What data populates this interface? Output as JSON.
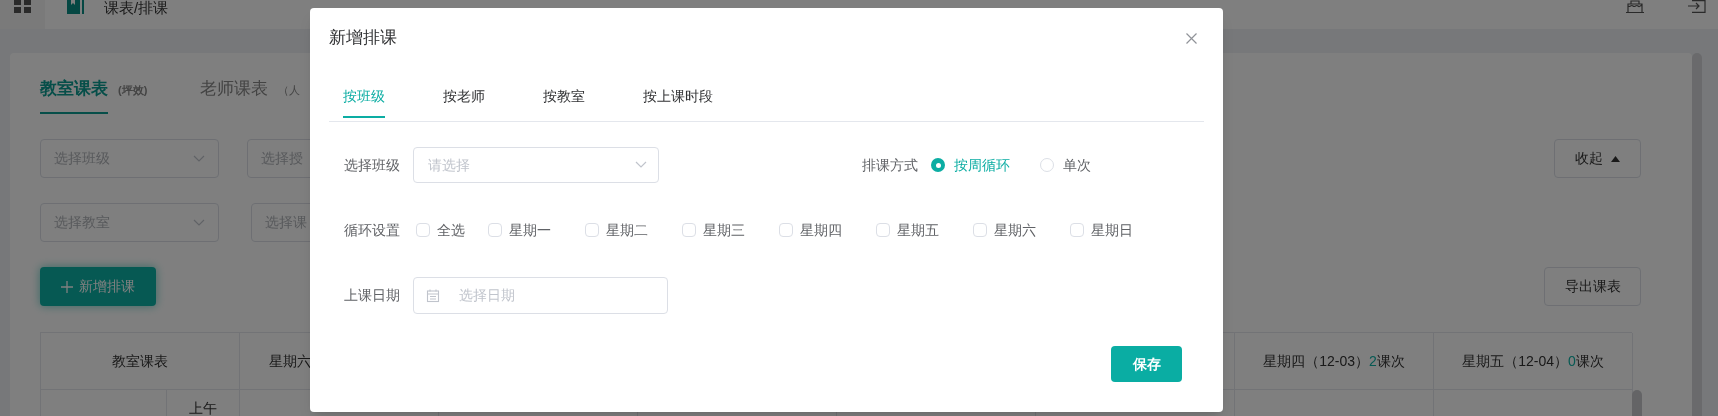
{
  "app_bar": {
    "breadcrumb": "课表/排课"
  },
  "page": {
    "tabs": [
      {
        "label": "教室课表",
        "note": "(坪效)",
        "selected": true
      },
      {
        "label": "老师课表",
        "note": "（人",
        "selected": false
      }
    ],
    "filters": [
      [
        {
          "placeholder": "选择班级"
        },
        {
          "placeholder": "选择授"
        }
      ],
      [
        {
          "placeholder": "选择教室"
        },
        {
          "placeholder": "选择课"
        }
      ]
    ],
    "collapse_button": "收起",
    "add_button": "新增排课",
    "export_button": "导出课表",
    "table": {
      "left_columns": [
        "教室课表",
        "星期六"
      ],
      "right_columns": [
        {
          "day": "星期四（12-03）",
          "count": "2",
          "unit": "课次"
        },
        {
          "day": "星期五（12-04）",
          "count": "0",
          "unit": "课次"
        }
      ],
      "rows": [
        {
          "period": "上午"
        }
      ]
    }
  },
  "dialog": {
    "title": "新增排课",
    "tabs": [
      {
        "label": "按班级",
        "selected": true
      },
      {
        "label": "按老师",
        "selected": false
      },
      {
        "label": "按教室",
        "selected": false
      },
      {
        "label": "按上课时段",
        "selected": false
      }
    ],
    "class_label": "选择班级",
    "class_placeholder": "请选择",
    "mode_label": "排课方式",
    "mode_options": [
      {
        "label": "按周循环",
        "selected": true
      },
      {
        "label": "单次",
        "selected": false
      }
    ],
    "repeat_label": "循环设置",
    "repeat_options": [
      {
        "kind": "all",
        "label": "全选",
        "checked": false
      },
      {
        "kind": "day",
        "label": "星期一",
        "checked": false
      },
      {
        "kind": "day",
        "label": "星期二",
        "checked": false
      },
      {
        "kind": "day",
        "label": "星期三",
        "checked": false
      },
      {
        "kind": "day",
        "label": "星期四",
        "checked": false
      },
      {
        "kind": "day",
        "label": "星期五",
        "checked": false
      },
      {
        "kind": "day",
        "label": "星期六",
        "checked": false
      },
      {
        "kind": "day",
        "label": "星期日",
        "checked": false
      }
    ],
    "date_label": "上课日期",
    "date_placeholder": "选择日期",
    "save_button": "保存"
  }
}
